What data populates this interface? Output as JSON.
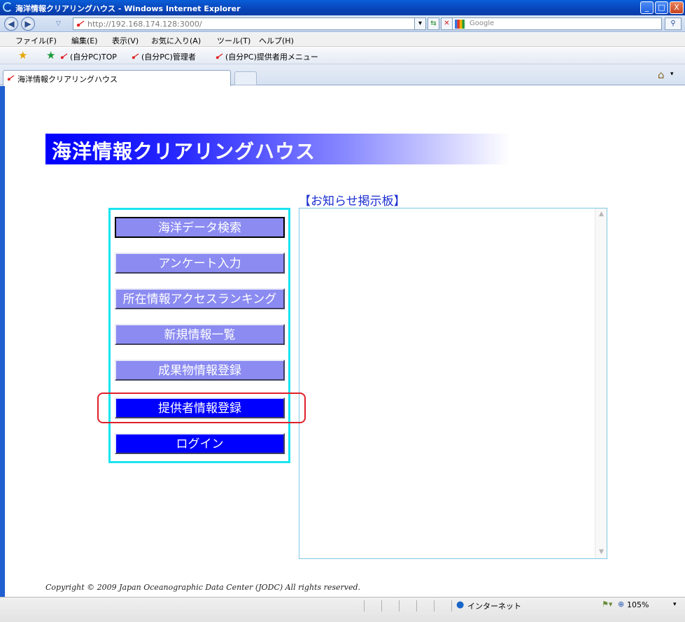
{
  "window": {
    "title": "海洋情報クリアリングハウス - Windows Internet Explorer",
    "minimize_label": "_",
    "maximize_label": "□",
    "close_label": "X"
  },
  "address": {
    "back_icon": "◀",
    "forward_icon": "▶",
    "url": "http://192.168.174.128:3000/",
    "search_placeholder": "Google"
  },
  "menubar": {
    "items": [
      "ファイル(F)",
      "編集(E)",
      "表示(V)",
      "お気に入り(A)",
      "ツール(T)",
      "ヘルプ(H)"
    ]
  },
  "favorites": {
    "links": [
      "(自分PC)TOP",
      "(自分PC)管理者",
      "(自分PC)提供者用メニュー"
    ]
  },
  "tabs": {
    "active_label": "海洋情報クリアリングハウス"
  },
  "page": {
    "banner_title": "海洋情報クリアリングハウス",
    "notice_title": "【お知らせ掲示板】",
    "nav_buttons": [
      {
        "label": "海洋データ検索",
        "style": "light"
      },
      {
        "label": "アンケート入力",
        "style": "light"
      },
      {
        "label": "所在情報アクセスランキング",
        "style": "light"
      },
      {
        "label": "新規情報一覧",
        "style": "light"
      },
      {
        "label": "成果物情報登録",
        "style": "light"
      },
      {
        "label": "提供者情報登録",
        "style": "dark"
      },
      {
        "label": "ログイン",
        "style": "dark"
      }
    ],
    "copyright": "Copyright © 2009 Japan Oceanographic Data Center (JODC) All rights reserved."
  },
  "status": {
    "zone": "インターネット",
    "zoom": "105%"
  },
  "colors": {
    "button_light": "#8b8bf2",
    "button_dark": "#0000ff",
    "menu_border": "#19e4f0",
    "highlight": "#e0202a"
  }
}
